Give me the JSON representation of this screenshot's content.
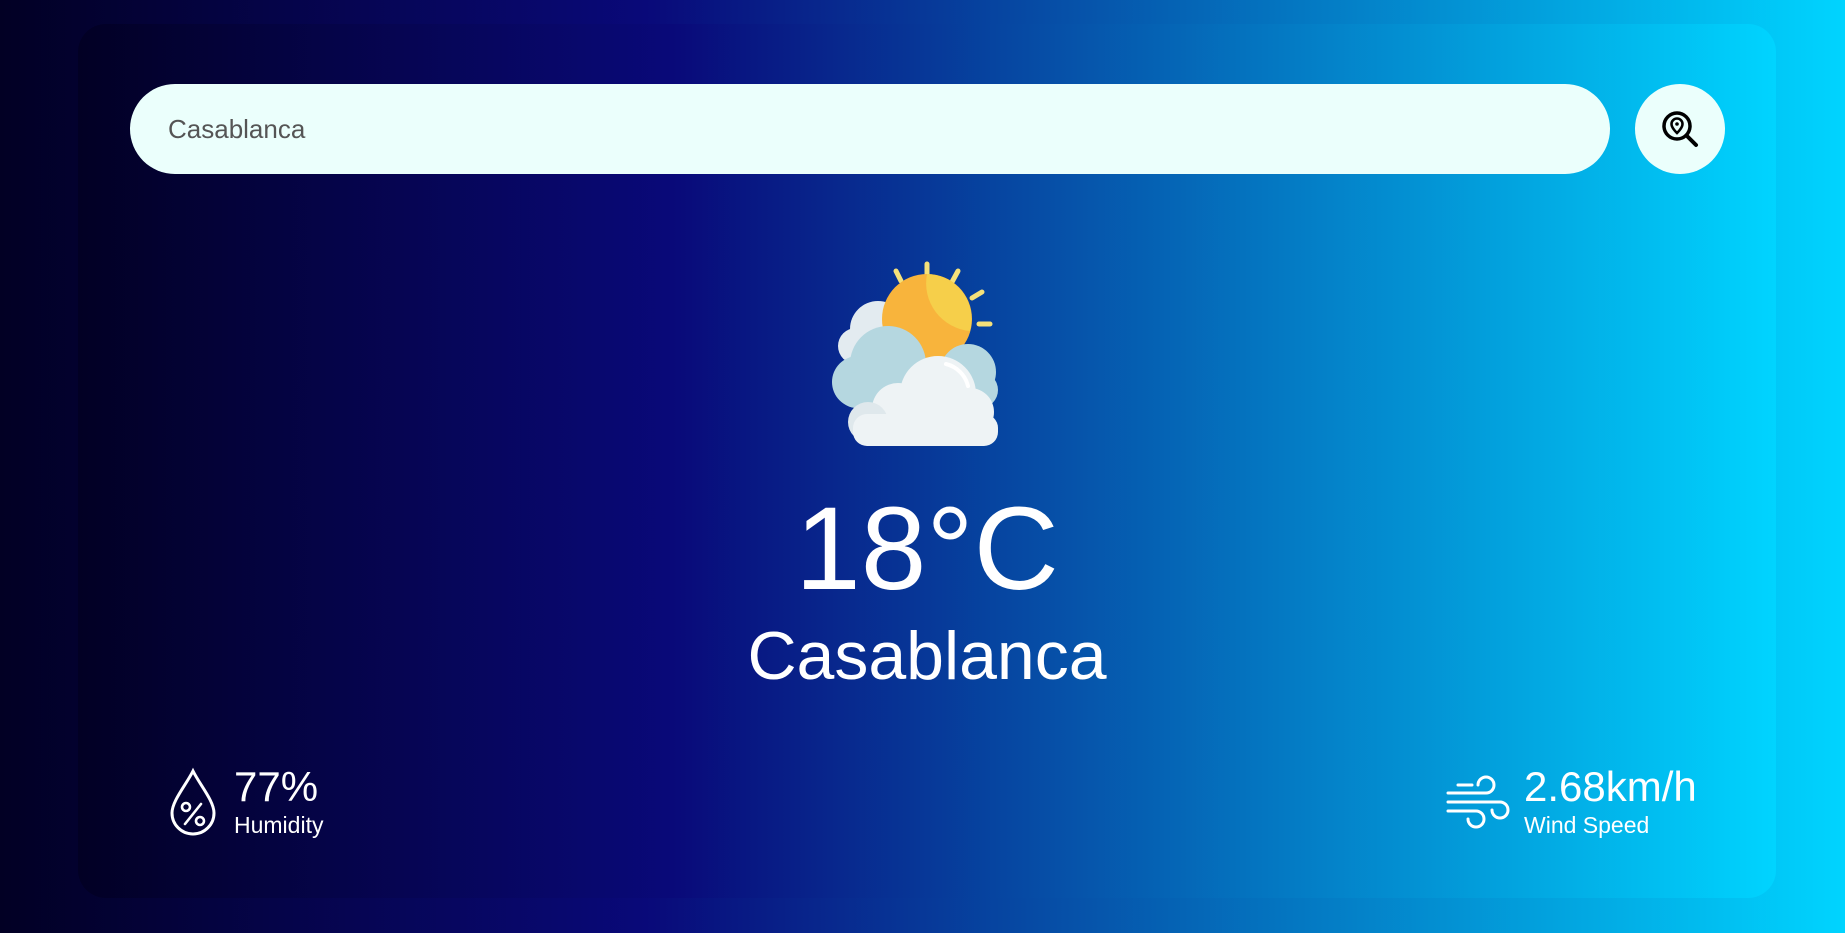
{
  "search": {
    "value": "Casablanca",
    "icon": "search-location-icon"
  },
  "weather": {
    "icon": "partly-cloudy-icon",
    "temperature": "18°C",
    "city": "Casablanca"
  },
  "humidity": {
    "icon": "humidity-drop-icon",
    "value": "77%",
    "label": "Humidity"
  },
  "wind": {
    "icon": "wind-icon",
    "value": "2.68km/h",
    "label": "Wind Speed"
  },
  "colors": {
    "gradient_start": "#020024",
    "gradient_mid": "#090979",
    "gradient_end": "#00d4ff",
    "search_bg": "#ebfffc",
    "text": "#ffffff"
  }
}
